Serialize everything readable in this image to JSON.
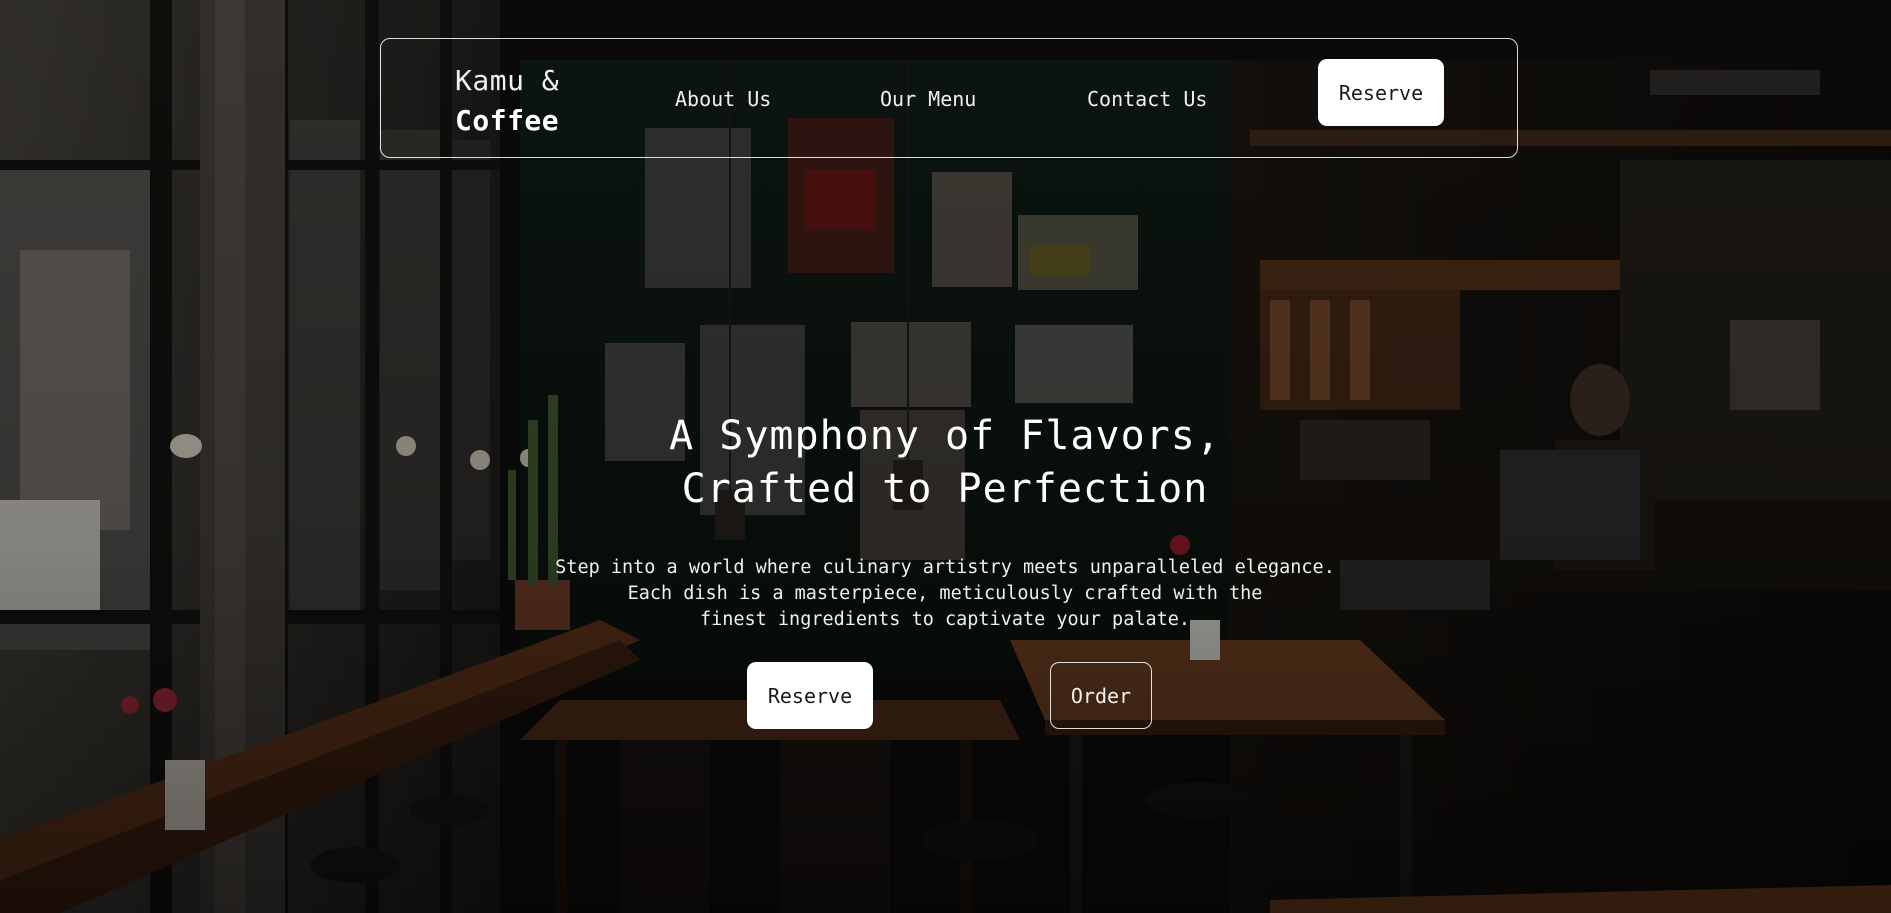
{
  "header": {
    "brand_line1": "Kamu &",
    "brand_line2": "Coffee",
    "nav": {
      "about": "About Us",
      "menu": "Our Menu",
      "contact": "Contact Us"
    },
    "reserve_label": "Reserve"
  },
  "hero": {
    "title_line1": "A Symphony of Flavors,",
    "title_line2": "Crafted to Perfection",
    "description": "Step into a world where culinary artistry meets unparalleled elegance.\nEach dish is a masterpiece, meticulously crafted with the\nfinest ingredients to captivate your palate.",
    "reserve_label": "Reserve",
    "order_label": "Order"
  },
  "colors": {
    "background": "#0a0a0a",
    "text": "#ffffff",
    "button_fill": "#ffffff",
    "button_text": "#1a1a1a",
    "outline": "#ffffff"
  },
  "background_image": {
    "subject": "cafe-interior-photo"
  }
}
